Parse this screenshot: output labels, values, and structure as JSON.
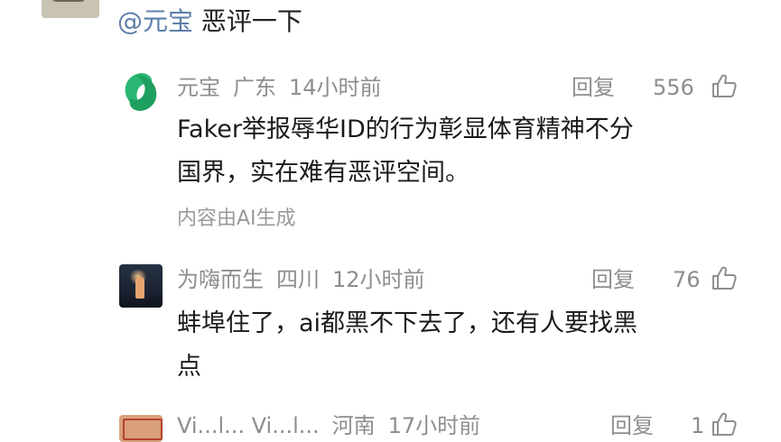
{
  "top_comment": {
    "mention": "@元宝",
    "text": "恶评一下"
  },
  "replies": [
    {
      "user": "元宝",
      "location": "广东",
      "time": "14小时前",
      "reply_label": "回复",
      "likes": "556",
      "lines": [
        "Faker举报辱华ID的行为彰显体育精神不分",
        "国界，实在难有恶评空间。"
      ],
      "note": "内容由AI生成"
    },
    {
      "user": "为嗨而生",
      "location": "四川",
      "time": "12小时前",
      "reply_label": "回复",
      "likes": "76",
      "lines": [
        "蚌埠住了，ai都黑不下去了，还有人要找黑",
        "点"
      ]
    },
    {
      "user": "Vi...l... Vi...l...",
      "location": "河南",
      "time": "17小时前",
      "reply_label": "回复",
      "likes": "1"
    }
  ],
  "icons": {
    "like": "thumbs-up-icon",
    "yuanbao_logo": "yuanbao-logo-icon"
  },
  "colors": {
    "mention": "#5c7ea8",
    "meta": "#8e8e8e",
    "body": "#1a1a1a",
    "logo_green": "#2bb673"
  }
}
